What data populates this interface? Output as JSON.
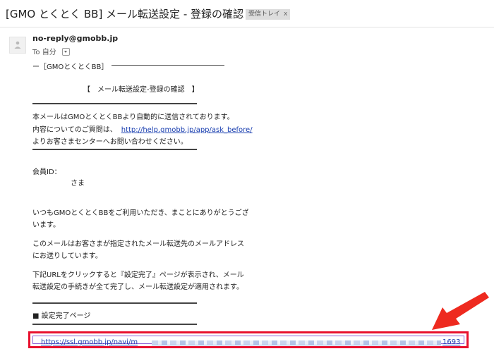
{
  "email": {
    "subject": "[GMO とくとく BB] メール転送設定 - 登録の確認",
    "label_chip": "受信トレイ",
    "label_remove": "x",
    "sender": "no-reply@gmobb.jp",
    "to_prefix": "To",
    "to_name": "自分",
    "body": {
      "header_rule_text": "ー［GMOとくとくBB］",
      "title": "【　メール転送設定-登録の確認　】",
      "intro_line1": "本メールはGMOとくとくBBより自動的に送信されております。",
      "intro_line2_prefix": "内容についてのご質問は、",
      "help_link": "http://help.gmobb.jp/app/ask_before/",
      "intro_line3": "よりお客さまセンターへお問い合わせください。",
      "member_id_label": "会員ID：",
      "honorific": "さま",
      "thanks_line1": "いつもGMOとくとくBBをご利用いただき、まことにありがとうござ",
      "thanks_line2": "います。",
      "notice_line1": "このメールはお客さまが指定されたメール転送先のメールアドレス",
      "notice_line2": "にお送りしています。",
      "instruction_line1": "下記URLをクリックすると『設定完了』ページが表示され、メール",
      "instruction_line2": "転送設定の手続きが全て完了し、メール転送設定が適用されます。",
      "section_label": "■ 設定完了ページ",
      "confirm_url_start": "https://ssl.gmobb.jp/navi/m",
      "confirm_url_end": "1693"
    }
  },
  "colors": {
    "link": "#1a3fb0",
    "highlight_box": "#e8112e",
    "arrow": "#ee2a1f"
  },
  "icons": {
    "avatar": "person-silhouette-icon",
    "to_dropdown": "chevron-down-icon",
    "callout": "arrow-pointer-icon"
  }
}
